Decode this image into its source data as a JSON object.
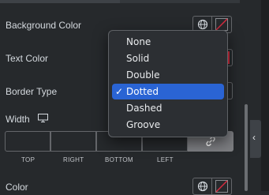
{
  "rows": {
    "background_color": "Background Color",
    "text_color": "Text Color",
    "border_type": "Border Type",
    "width": "Width",
    "color": "Color"
  },
  "dimensions": {
    "labels": [
      "TOP",
      "RIGHT",
      "BOTTOM",
      "LEFT"
    ]
  },
  "dropdown": {
    "options": [
      "None",
      "Solid",
      "Double",
      "Dotted",
      "Dashed",
      "Groove"
    ],
    "selected": "Dotted",
    "check_glyph": "✓"
  },
  "collapse_glyph": "‹",
  "colors": {
    "panel_bg": "#26292c",
    "selected_bg": "#2a64d4",
    "clear_slash": "#d72b3f"
  },
  "icons": [
    "globe-icon",
    "clear-color-icon",
    "desktop-icon",
    "link-icon",
    "chevron-left-icon"
  ]
}
